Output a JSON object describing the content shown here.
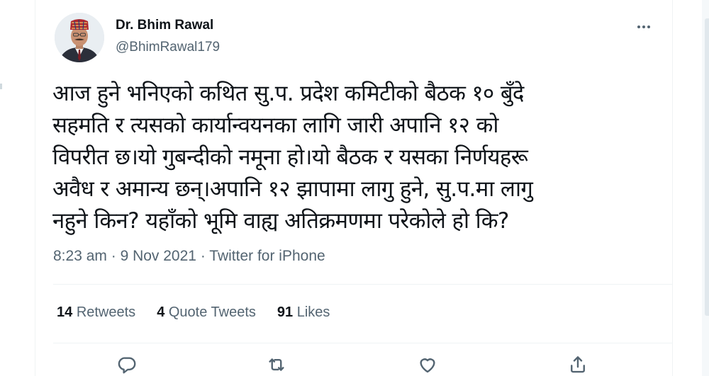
{
  "author": {
    "display_name": "Dr. Bhim Rawal",
    "handle": "@BhimRawal179"
  },
  "tweet": {
    "text": "आज हुने भनिएको कथित सु.प. प्रदेश कमिटीको बैठक  १० बुँदे\nसहमति र त्यसको कार्यान्वयनका लागि जारी अपानि १२ को\nविपरीत छ।यो गुबन्दीको नमूना हो।यो बैठक र यसका निर्णयहरू\nअवैध र अमान्य छन्।अपानि १२ झापामा लागु हुने, सु.प.मा लागु\nनहुने किन? यहाँको भूमि वाह्य अतिक्रमणमा परेकोले हो कि?",
    "time": "8:23 am",
    "date": "9 Nov 2021",
    "source": "Twitter for iPhone",
    "separator": " · "
  },
  "stats": {
    "retweets_count": "14",
    "retweets_label": "Retweets",
    "quotes_count": "4",
    "quotes_label": "Quote Tweets",
    "likes_count": "91",
    "likes_label": "Likes"
  },
  "icons": {
    "more": "more-dots-icon",
    "reply": "reply-icon",
    "retweet": "retweet-icon",
    "like": "heart-icon",
    "share": "share-icon"
  },
  "colors": {
    "text": "#0f1419",
    "secondary": "#536471",
    "border": "#eff3f4"
  }
}
